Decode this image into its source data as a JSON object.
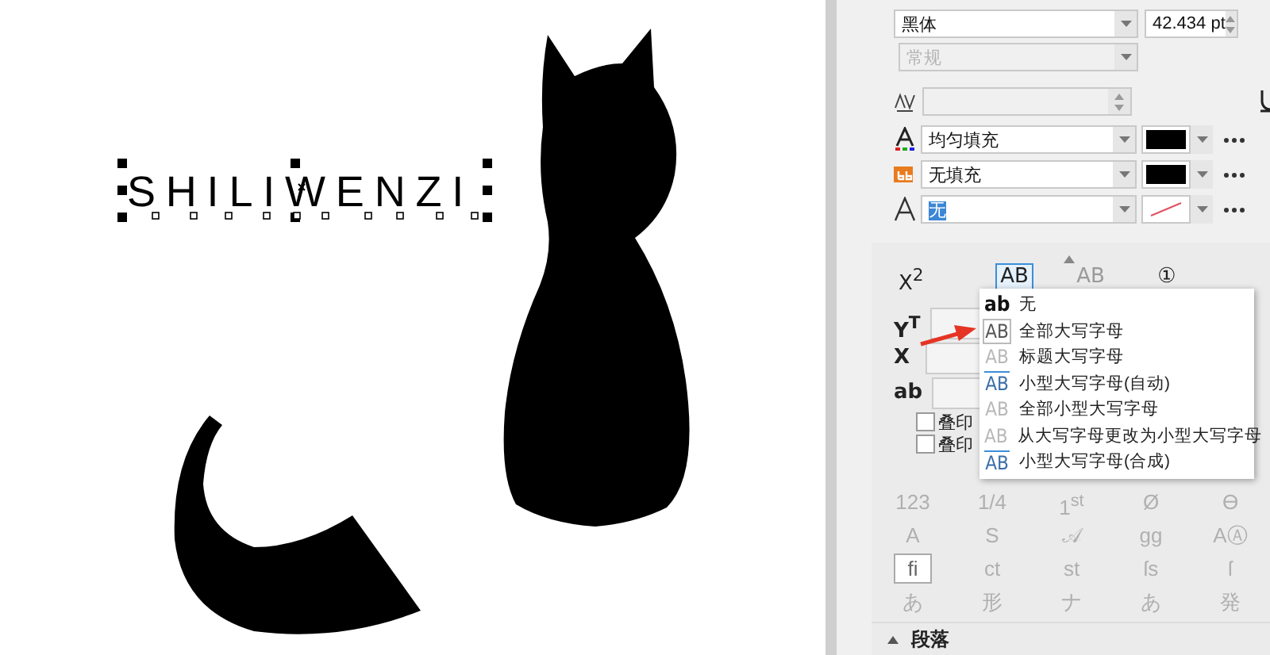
{
  "canvas": {
    "text": "SHILIWENZI",
    "selected": true
  },
  "character": {
    "font": "黑体",
    "size": "42.434 pt",
    "style": {
      "value": "常规",
      "disabled": true
    },
    "kerning": {
      "disabled": true
    },
    "fills": [
      {
        "kind": "text",
        "value": "均匀填充",
        "color": "#000000",
        "text_selected": false
      },
      {
        "kind": "background",
        "value": "无填充",
        "color": "#000000",
        "text_selected": false
      },
      {
        "kind": "outline",
        "value": "无",
        "text_selected": true
      }
    ]
  },
  "position_buttons": [
    {
      "label": "X$^{2}$",
      "selected": false,
      "disabled": false
    },
    {
      "label": "AB",
      "selected": true,
      "disabled": false
    },
    {
      "label": "AB",
      "selected": false,
      "disabled": true
    },
    {
      "label": "①",
      "selected": false,
      "disabled": false
    }
  ],
  "offsets": [
    {
      "label": "Y$^{T}$"
    },
    {
      "label": "X"
    },
    {
      "label": "ab"
    }
  ],
  "checkboxes": [
    {
      "label": "叠印",
      "checked": false
    },
    {
      "label": "叠印",
      "checked": false
    }
  ],
  "capitals_menu": [
    {
      "icon": "ab",
      "kind": "plain",
      "label": "无",
      "highlighted": false
    },
    {
      "icon": "AB",
      "kind": "caps",
      "label": "全部大写字母",
      "highlighted": true
    },
    {
      "icon": "AB",
      "kind": "muted",
      "label": "标题大写字母",
      "highlighted": false
    },
    {
      "icon": "AB",
      "kind": "small",
      "label": "小型大写字母(自动)",
      "highlighted": false
    },
    {
      "icon": "AB",
      "kind": "muted",
      "label": "全部小型大写字母",
      "highlighted": false
    },
    {
      "icon": "AB",
      "kind": "muted",
      "label": "从大写字母更改为小型大写字母",
      "highlighted": false
    },
    {
      "icon": "AB",
      "kind": "small",
      "label": "小型大写字母(合成)",
      "highlighted": false
    }
  ],
  "glyphs": [
    [
      {
        "glyph": "123",
        "selected": false
      },
      {
        "glyph": "1/4",
        "selected": false
      },
      {
        "glyph": "1$^{st}$",
        "selected": false
      },
      {
        "glyph": "Ø",
        "selected": false
      },
      {
        "glyph": "ϴ",
        "selected": false
      }
    ],
    [
      {
        "glyph": "A",
        "selected": false
      },
      {
        "glyph": "S",
        "selected": false
      },
      {
        "glyph": "𝒜",
        "selected": false
      },
      {
        "glyph": "gg",
        "selected": false
      },
      {
        "glyph": "AⒶ",
        "selected": false
      }
    ],
    [
      {
        "glyph": "fi",
        "selected": true
      },
      {
        "glyph": "ct",
        "selected": false
      },
      {
        "glyph": "st",
        "selected": false
      },
      {
        "glyph": "ſs",
        "selected": false
      },
      {
        "glyph": "ſ",
        "selected": false
      }
    ],
    [
      {
        "glyph": "あ",
        "selected": false
      },
      {
        "glyph": "形",
        "selected": false
      },
      {
        "glyph": "ナ",
        "selected": false
      },
      {
        "glyph": "あ",
        "selected": false
      },
      {
        "glyph": "発",
        "selected": false
      }
    ]
  ],
  "section": {
    "title": "段落",
    "expanded": false
  }
}
